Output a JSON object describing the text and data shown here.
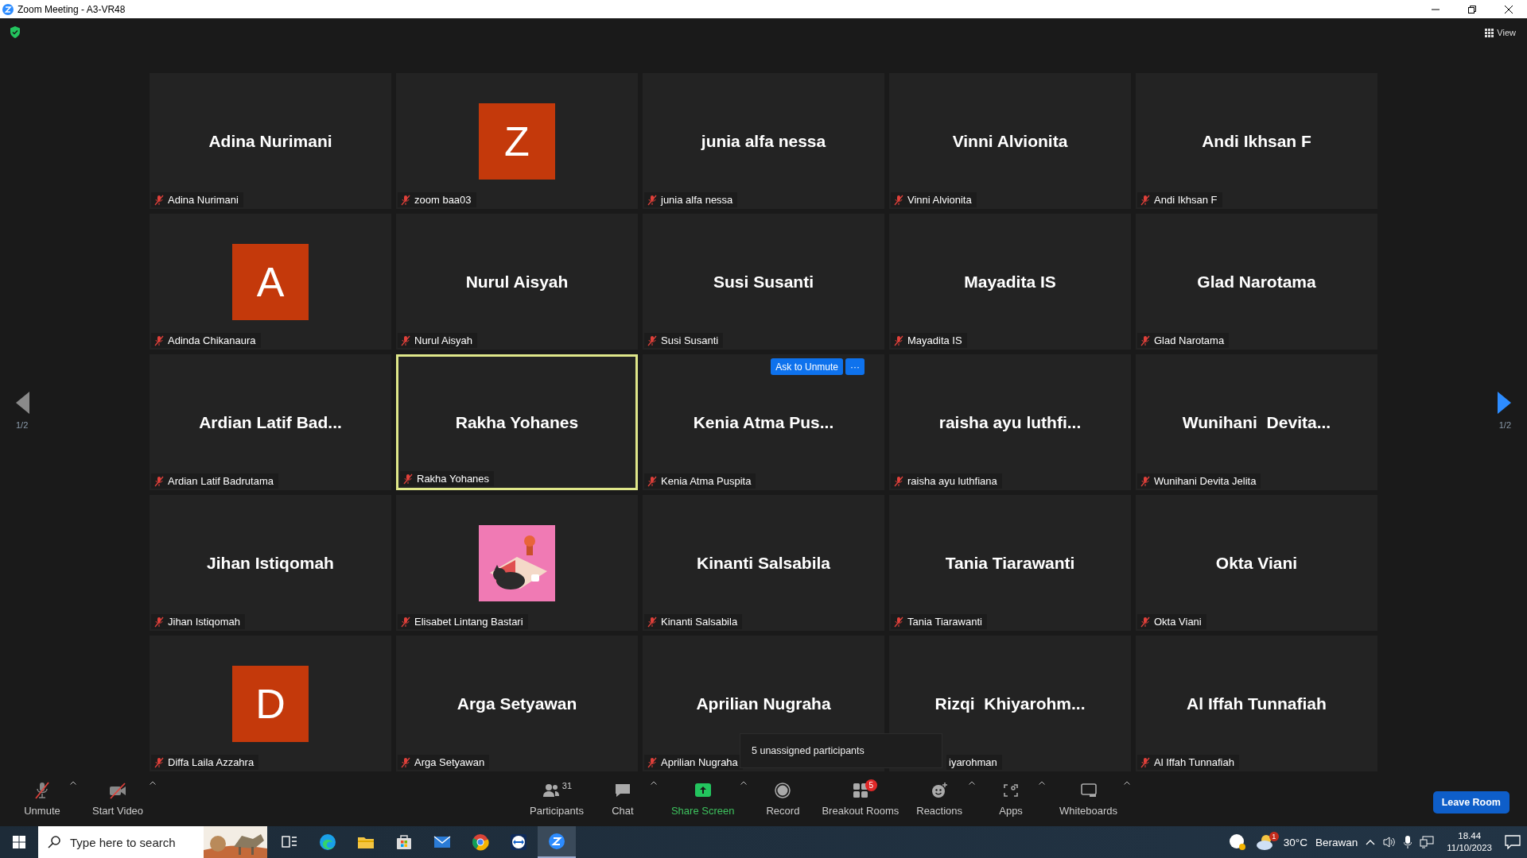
{
  "window": {
    "title": "Zoom Meeting - A3-VR48"
  },
  "top_bar": {
    "view_button": "View"
  },
  "pager": {
    "left": "1/2",
    "right": "1/2"
  },
  "tiles": [
    {
      "kind": "name",
      "display": "Adina Nurimani",
      "label": "Adina Nurimani",
      "active_speaker": false
    },
    {
      "kind": "avatar",
      "display": "Z",
      "label": "zoom baa03",
      "active_speaker": false
    },
    {
      "kind": "name",
      "display": "junia alfa nessa",
      "label": "junia alfa nessa",
      "active_speaker": false
    },
    {
      "kind": "name",
      "display": "Vinni Alvionita",
      "label": "Vinni Alvionita",
      "active_speaker": false
    },
    {
      "kind": "name",
      "display": "Andi Ikhsan F",
      "label": "Andi Ikhsan F",
      "active_speaker": false
    },
    {
      "kind": "avatar",
      "display": "A",
      "label": "Adinda Chikanaura",
      "active_speaker": false
    },
    {
      "kind": "name",
      "display": "Nurul Aisyah",
      "label": "Nurul Aisyah",
      "active_speaker": false
    },
    {
      "kind": "name",
      "display": "Susi Susanti",
      "label": "Susi Susanti",
      "active_speaker": false
    },
    {
      "kind": "name",
      "display": "Mayadita IS",
      "label": "Mayadita IS",
      "active_speaker": false
    },
    {
      "kind": "name",
      "display": "Glad Narotama",
      "label": "Glad Narotama",
      "active_speaker": false
    },
    {
      "kind": "name",
      "display": "Ardian Latif Bad...",
      "label": "Ardian Latif Badrutama",
      "active_speaker": false
    },
    {
      "kind": "name",
      "display": "Rakha Yohanes",
      "label": "Rakha Yohanes",
      "active_speaker": true
    },
    {
      "kind": "name",
      "display": "Kenia Atma Pus...",
      "label": "Kenia Atma Puspita",
      "active_speaker": false,
      "actions": [
        "Ask to Unmute",
        "···"
      ]
    },
    {
      "kind": "name",
      "display": "raisha ayu luthfi...",
      "label": "raisha ayu luthfiana",
      "active_speaker": false
    },
    {
      "kind": "name",
      "display": "Wunihani  Devita...",
      "label": "Wunihani Devita Jelita",
      "active_speaker": false
    },
    {
      "kind": "name",
      "display": "Jihan Istiqomah",
      "label": "Jihan Istiqomah",
      "active_speaker": false
    },
    {
      "kind": "picture",
      "label": "Elisabet Lintang Bastari",
      "active_speaker": false
    },
    {
      "kind": "name",
      "display": "Kinanti Salsabila",
      "label": "Kinanti Salsabila",
      "active_speaker": false
    },
    {
      "kind": "name",
      "display": "Tania Tiarawanti",
      "label": "Tania Tiarawanti",
      "active_speaker": false
    },
    {
      "kind": "name",
      "display": "Okta Viani",
      "label": "Okta Viani",
      "active_speaker": false
    },
    {
      "kind": "avatar",
      "display": "D",
      "label": "Diffa Laila Azzahra",
      "active_speaker": false
    },
    {
      "kind": "name",
      "display": "Arga Setyawan",
      "label": "Arga Setyawan",
      "active_speaker": false
    },
    {
      "kind": "name",
      "display": "Aprilian Nugraha",
      "label": "Aprilian Nugraha",
      "active_speaker": false
    },
    {
      "kind": "name",
      "display": "Rizqi  Khiyarohm...",
      "label": "iyarohman",
      "active_speaker": false,
      "covered": true
    },
    {
      "kind": "name",
      "display": "Al Iffah Tunnafiah",
      "label": "Al Iffah Tunnafiah",
      "active_speaker": false
    }
  ],
  "popup": {
    "text": "5 unassigned participants"
  },
  "toolbar": {
    "left": [
      {
        "kind": "mic",
        "label": "Unmute",
        "caret": true
      },
      {
        "kind": "video",
        "label": "Start Video",
        "caret": true
      }
    ],
    "center": [
      {
        "kind": "participants",
        "label": "Participants",
        "count": "31",
        "caret": false
      },
      {
        "kind": "chat",
        "label": "Chat",
        "caret": true
      },
      {
        "kind": "share",
        "label": "Share Screen",
        "caret": true
      },
      {
        "kind": "record",
        "label": "Record",
        "caret": false
      },
      {
        "kind": "breakout",
        "label": "Breakout Rooms",
        "badge": "5",
        "caret": false
      },
      {
        "kind": "reactions",
        "label": "Reactions",
        "caret": true
      },
      {
        "kind": "apps",
        "label": "Apps",
        "caret": true
      },
      {
        "kind": "whiteboard",
        "label": "Whiteboards",
        "caret": true
      }
    ],
    "leave": "Leave Room"
  },
  "taskbar": {
    "search": {
      "placeholder": "Type here to search"
    },
    "apps": [
      {
        "kind": "taskview",
        "selected": false
      },
      {
        "kind": "edge",
        "selected": false
      },
      {
        "kind": "explorer",
        "selected": false
      },
      {
        "kind": "store",
        "selected": false
      },
      {
        "kind": "mail",
        "selected": false
      },
      {
        "kind": "chrome",
        "selected": false
      },
      {
        "kind": "teamviewer",
        "selected": false
      },
      {
        "kind": "zoom",
        "selected": true
      }
    ],
    "weather": {
      "badge": "1",
      "temp": "30°C",
      "condition": "Berawan"
    },
    "time": "18.44",
    "date": "11/10/2023"
  }
}
